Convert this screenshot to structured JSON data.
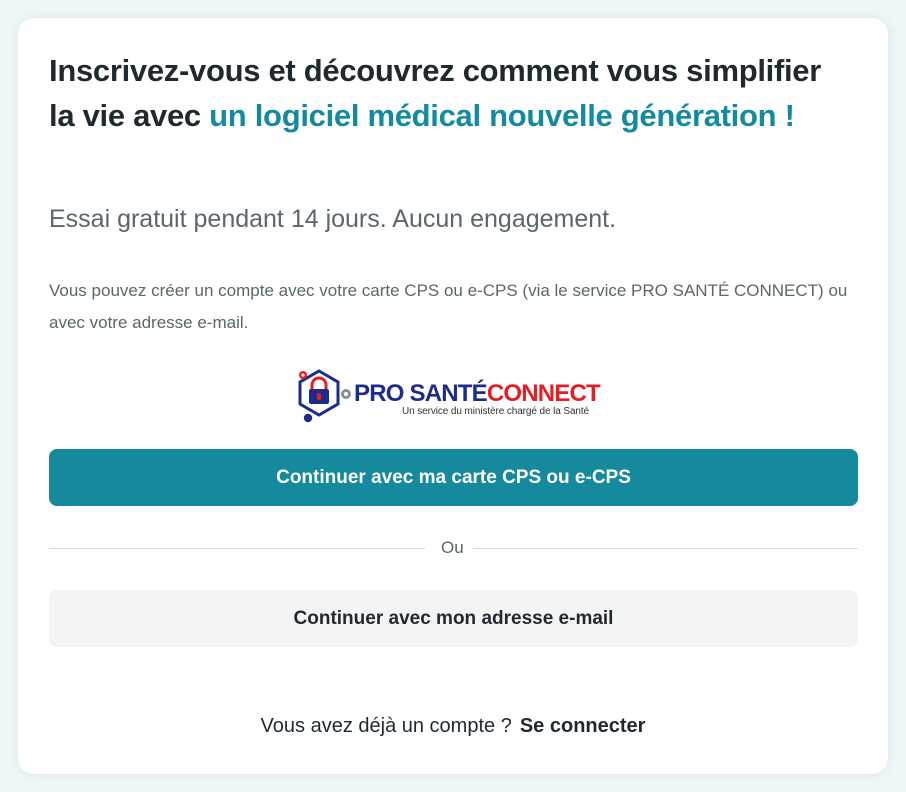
{
  "heading": {
    "prefix": "Inscrivez-vous et découvrez comment vous simplifier la vie avec ",
    "highlight": "un logiciel médical nouvelle génération !"
  },
  "subtitle": "Essai gratuit pendant 14 jours. Aucun engagement.",
  "description": "Vous pouvez créer un compte avec votre carte CPS ou e-CPS (via le service PRO SANTÉ CONNECT) ou avec votre adresse e-mail.",
  "logo": {
    "pro": "PRO",
    "sante": "SANTÉ",
    "connect": "CONNECT",
    "tagline": "Un service du ministère chargé de la Santé"
  },
  "buttons": {
    "cps_label": "Continuer avec ma carte CPS ou e-CPS",
    "email_label": "Continuer avec mon adresse e-mail"
  },
  "divider_label": "Ou",
  "login": {
    "prompt": "Vous avez déjà un compte ?",
    "link_label": "Se connecter"
  },
  "colors": {
    "accent": "#128b9e",
    "primary_button": "#158a9d",
    "secondary_button": "#f3f4f4",
    "logo_blue": "#1d2c8a",
    "logo_red": "#e31e24"
  }
}
